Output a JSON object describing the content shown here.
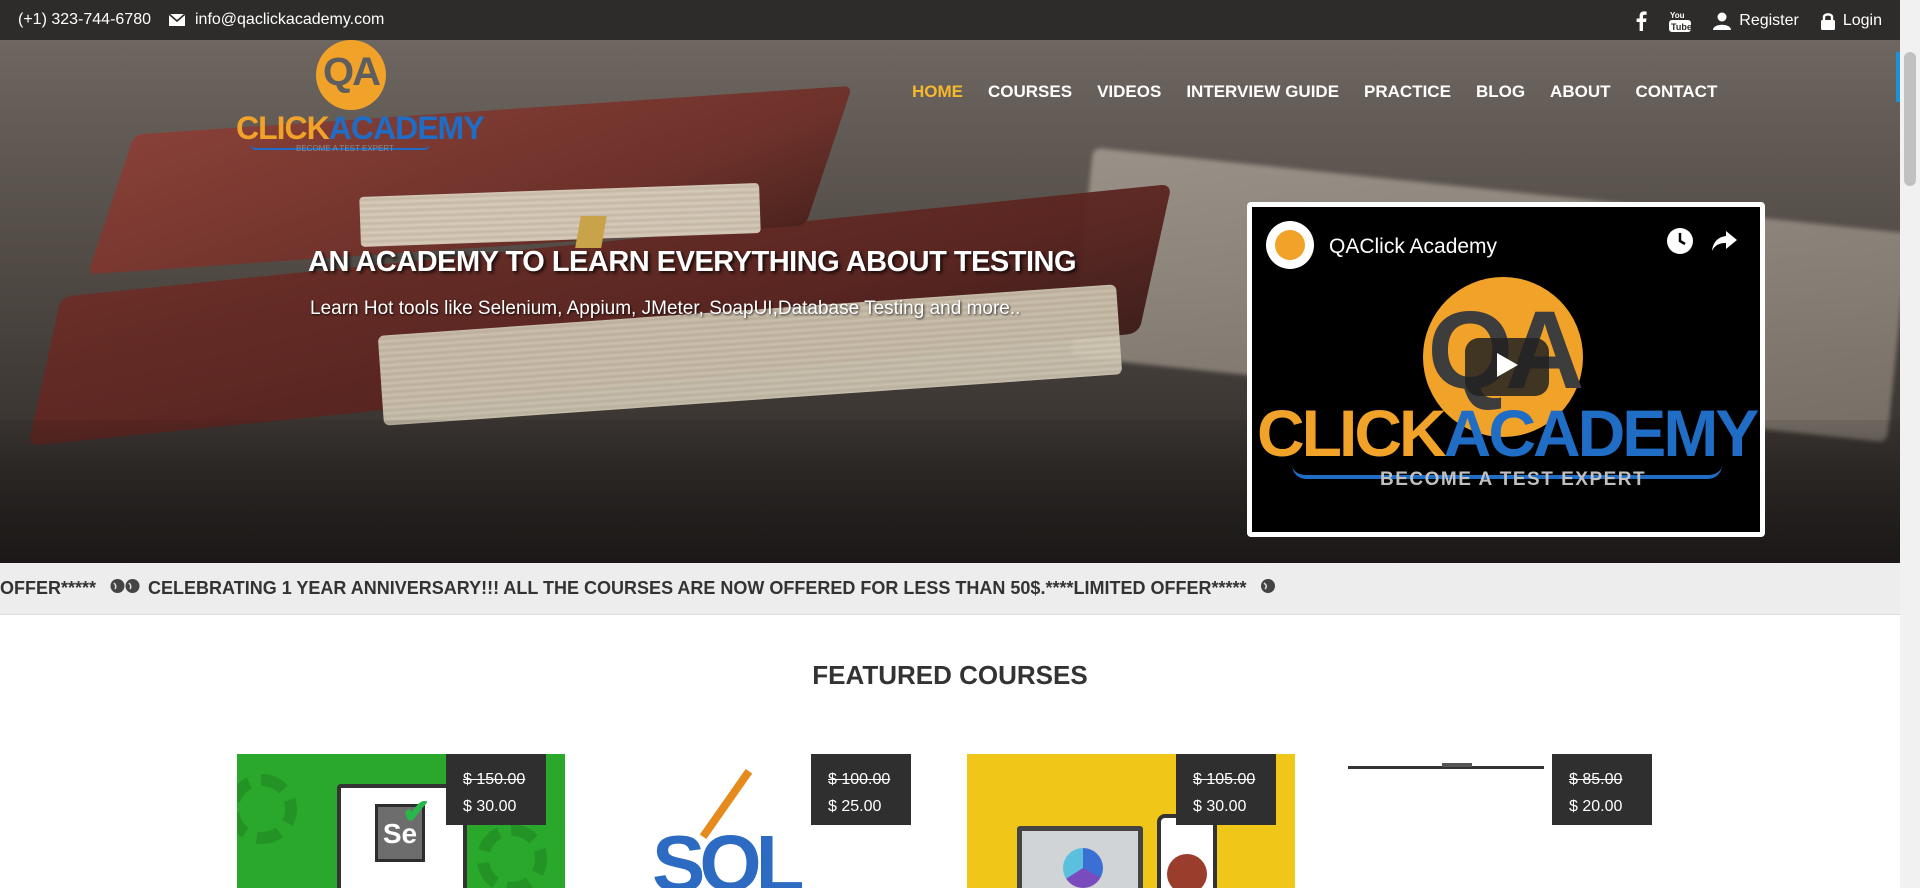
{
  "topbar": {
    "phone": "(+1) 323-744-6780",
    "email": "info@qaclickacademy.com",
    "register": "Register",
    "login": "Login"
  },
  "logo": {
    "qa": "QA",
    "click": "CLICK",
    "academy": "ACADEMY",
    "tagline": "BECOME A TEST EXPERT"
  },
  "nav": {
    "items": [
      "HOME",
      "COURSES",
      "VIDEOS",
      "INTERVIEW GUIDE",
      "PRACTICE",
      "BLOG",
      "ABOUT",
      "CONTACT"
    ],
    "active": "HOME",
    "active_color": "#f5b82e"
  },
  "hero": {
    "title": "AN ACADEMY TO LEARN EVERYTHING ABOUT TESTING",
    "subtitle": "Learn Hot tools like Selenium, Appium, JMeter, SoapUI,Database Testing and more.."
  },
  "video": {
    "channel": "QAClick Academy",
    "logo_qa": "QA",
    "logo_click": "CLICK",
    "logo_academy": "ACADEMY",
    "logo_tagline": "BECOME A TEST EXPERT"
  },
  "marquee": {
    "lead": "OFFER*****",
    "text": "CELEBRATING 1 YEAR ANNIVERSARY!!! ALL THE COURSES ARE NOW OFFERED FOR LESS THAN 50$.****LIMITED OFFER*****"
  },
  "featured": {
    "title": "FEATURED COURSES",
    "courses": [
      {
        "old_price": "$ 150.00",
        "price": "$ 30.00"
      },
      {
        "old_price": "$ 100.00",
        "price": "$ 25.00"
      },
      {
        "old_price": "$ 105.00",
        "price": "$ 30.00"
      },
      {
        "old_price": "$ 85.00",
        "price": "$ 20.00"
      }
    ]
  },
  "colors": {
    "topbar_bg": "#2e2c2a",
    "accent_orange": "#f1a229",
    "accent_blue": "#1f6dc5"
  }
}
